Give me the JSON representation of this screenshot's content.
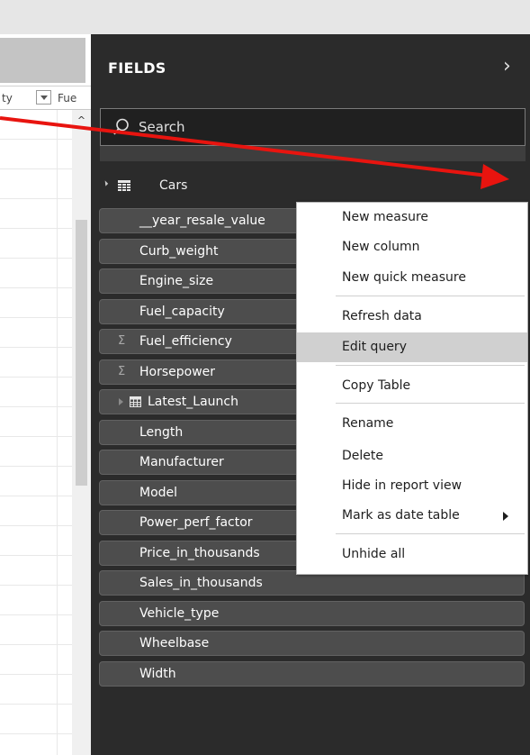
{
  "left_panel": {
    "col_headers": [
      "ty",
      "Fue"
    ],
    "scroll_up_glyph": "^"
  },
  "fields_pane": {
    "title": "FIELDS",
    "collapse_glyph": "›",
    "search": {
      "placeholder": "Search",
      "value": ""
    },
    "table": {
      "name": "Cars",
      "expanded": true,
      "icon": "table-icon"
    },
    "fields": [
      {
        "label": "__year_resale_value",
        "kind": "column"
      },
      {
        "label": "Curb_weight",
        "kind": "column"
      },
      {
        "label": "Engine_size",
        "kind": "column"
      },
      {
        "label": "Fuel_capacity",
        "kind": "column"
      },
      {
        "label": "Fuel_efficiency",
        "kind": "sum"
      },
      {
        "label": "Horsepower",
        "kind": "sum"
      },
      {
        "label": "Latest_Launch",
        "kind": "date-hierarchy"
      },
      {
        "label": "Length",
        "kind": "column"
      },
      {
        "label": "Manufacturer",
        "kind": "column"
      },
      {
        "label": "Model",
        "kind": "column"
      },
      {
        "label": "Power_perf_factor",
        "kind": "column"
      },
      {
        "label": "Price_in_thousands",
        "kind": "column"
      },
      {
        "label": "Sales_in_thousands",
        "kind": "column"
      },
      {
        "label": "Vehicle_type",
        "kind": "column"
      },
      {
        "label": "Wheelbase",
        "kind": "column"
      },
      {
        "label": "Width",
        "kind": "column"
      }
    ],
    "sigma_glyph": "Σ"
  },
  "context_menu": {
    "items": [
      {
        "label": "New measure"
      },
      {
        "label": "New column"
      },
      {
        "label": "New quick measure"
      },
      {
        "label": "Refresh data"
      },
      {
        "label": "Edit query",
        "highlighted": true
      },
      {
        "label": "Copy Table"
      },
      {
        "label": "Rename"
      },
      {
        "label": "Delete"
      },
      {
        "label": "Hide in report view"
      },
      {
        "label": "Mark as date table",
        "has_submenu": true
      },
      {
        "label": "Unhide all"
      }
    ]
  },
  "colors": {
    "pane_bg": "#2b2b2b",
    "field_bg": "#4d4d4d",
    "menu_highlight": "#d0d0d0",
    "annotation_arrow": "#e8140f"
  }
}
